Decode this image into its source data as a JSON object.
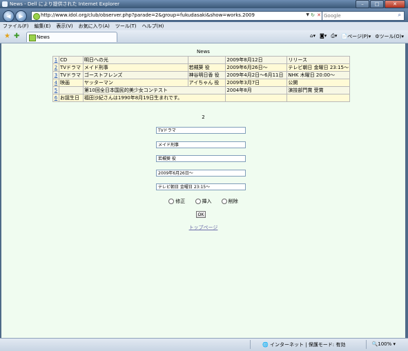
{
  "window": {
    "title": "News - Dell により提供された Internet Explorer"
  },
  "address": {
    "url": "http://www.idol.org/club/observer.php?parade=2&group=fukudasaki&show=works.2009"
  },
  "search": {
    "placeholder": "Google"
  },
  "menu": [
    "ファイル(F)",
    "編集(E)",
    "表示(V)",
    "お気に入り(A)",
    "ツール(T)",
    "ヘルプ(H)"
  ],
  "tab": {
    "label": "News"
  },
  "toolbar": {
    "page_label": "ページ(P)",
    "tools_label": "ツール(O)"
  },
  "page": {
    "title": "News",
    "rows": [
      {
        "n": "1",
        "type": "CD",
        "name": "明日への光",
        "role": "",
        "date": "2009年8月12日",
        "info": "リリース"
      },
      {
        "n": "2",
        "type": "TVドラマ",
        "name": "メイド刑事",
        "role": "若槻葵 役",
        "date": "2009年6月26日～",
        "info": "テレビ朝日 金曜日 23:15～"
      },
      {
        "n": "3",
        "type": "TVドラマ",
        "name": "ゴーストフレンズ",
        "role": "神谷明日香 役",
        "date": "2009年4月2日～6月11日",
        "info": "NHK 木曜日 20:00～"
      },
      {
        "n": "4",
        "type": "映画",
        "name": "ヤッターマン",
        "role": "アイちゃん 役",
        "date": "2009年3月7日",
        "info": "公開"
      },
      {
        "n": "5",
        "type": "",
        "name": "第10回全日本国民的美少女コンテスト",
        "role": "",
        "date": "2004年8月",
        "info": "演技部門賞 受賞"
      },
      {
        "n": "6",
        "type": "お誕生日",
        "name": "福田沙紀さんは1990年8月19日生まれです。",
        "role": "",
        "date": "",
        "info": ""
      }
    ],
    "record_no": "2",
    "form": {
      "type": "TVドラマ",
      "name": "メイド刑事",
      "role": "若槻葵 役",
      "date": "2009年6月26日～",
      "info": "テレビ朝日 金曜日 23:15～"
    },
    "radios": [
      "修正",
      "挿入",
      "削除"
    ],
    "ok_label": "OK",
    "top_link": "トップページ"
  },
  "status": {
    "zone": "インターネット | 保護モード: 有効",
    "zoom": "100%"
  }
}
